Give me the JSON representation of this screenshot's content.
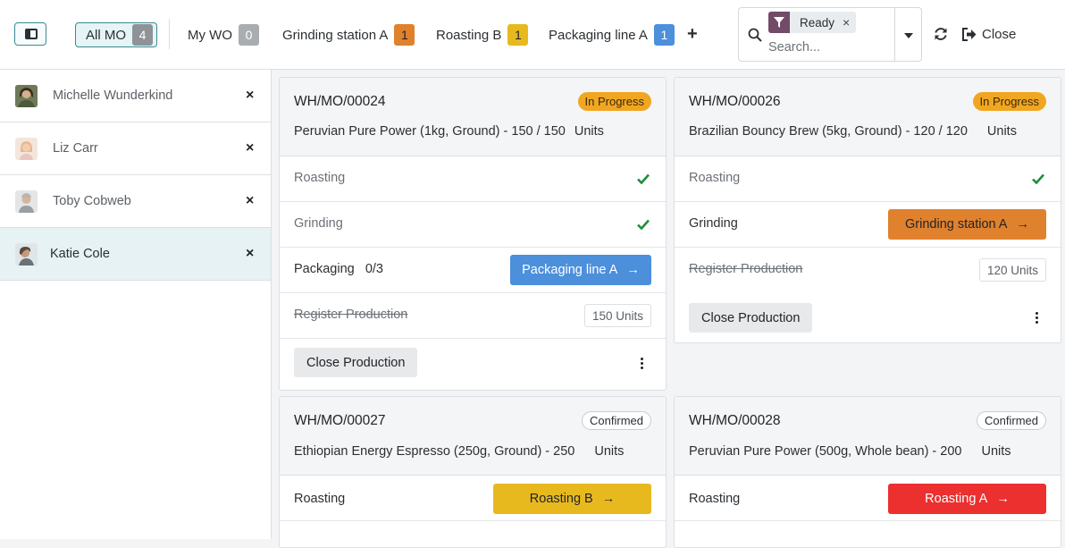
{
  "topbar": {
    "tabs": [
      {
        "label": "All MO",
        "count": "4",
        "badge_color": "#8f9398",
        "badge_text": "#ffffff"
      },
      {
        "label": "My WO",
        "count": "0",
        "badge_color": "#a9adb2",
        "badge_text": "#ffffff"
      },
      {
        "label": "Grinding station A",
        "count": "1",
        "badge_color": "#e0812d",
        "badge_text": "#1f2328"
      },
      {
        "label": "Roasting B",
        "count": "1",
        "badge_color": "#e8b91f",
        "badge_text": "#1f2328"
      },
      {
        "label": "Packaging line A",
        "count": "1",
        "badge_color": "#4c8fdb",
        "badge_text": "#ffffff"
      }
    ],
    "add_tab_icon": "plus-icon",
    "search": {
      "facet_icon": "filter-icon",
      "facet_label": "Ready",
      "facet_remove": "×",
      "placeholder": "Search..."
    },
    "close_label": "Close"
  },
  "employees": [
    {
      "name": "Michelle Wunderkind",
      "remove": "×"
    },
    {
      "name": "Liz Carr",
      "remove": "×"
    },
    {
      "name": "Toby Cobweb",
      "remove": "×"
    },
    {
      "name": "Katie Cole",
      "remove": "×"
    }
  ],
  "cards": [
    {
      "ref": "WH/MO/00024",
      "status": "In Progress",
      "product": "Peruvian Pure Power (1kg, Ground) - 150 / 150",
      "unit": "Units",
      "rows": [
        {
          "label": "Roasting",
          "done": true
        },
        {
          "label": "Grinding",
          "done": true
        },
        {
          "label": "Packaging",
          "qty": "0/3",
          "button": "Packaging line A"
        },
        {
          "label": "Register Production",
          "qty_box": "150 Units"
        }
      ],
      "close_label": "Close Production"
    },
    {
      "ref": "WH/MO/00026",
      "status": "In Progress",
      "product": "Brazilian Bouncy Brew (5kg, Ground) - 120 / 120",
      "unit": "Units",
      "rows": [
        {
          "label": "Roasting",
          "done": true
        },
        {
          "label": "Grinding",
          "button": "Grinding station A"
        },
        {
          "label": "Register Production",
          "qty_box": "120 Units"
        }
      ],
      "close_label": "Close Production"
    },
    {
      "ref": "WH/MO/00027",
      "status": "Confirmed",
      "product": "Ethiopian Energy Espresso (250g, Ground) - 250",
      "unit": "Units",
      "rows": [
        {
          "label": "Roasting",
          "button": "Roasting B"
        }
      ]
    },
    {
      "ref": "WH/MO/00028",
      "status": "Confirmed",
      "product": "Peruvian Pure Power (500g, Whole bean) - 200",
      "unit": "Units",
      "rows": [
        {
          "label": "Roasting",
          "button": "Roasting A"
        }
      ]
    }
  ],
  "colors": {
    "accent": "#3a8b93",
    "packaging_btn": "#4c8fdb",
    "grinding_btn": "#e0812d",
    "roasting_b_btn": "#e8b91f",
    "roasting_a_btn": "#ec2f2f",
    "check": "#1e8e3e"
  }
}
